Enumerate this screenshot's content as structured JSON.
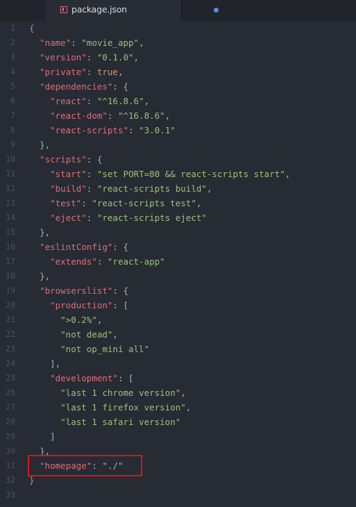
{
  "tab": {
    "filename": "package.json",
    "icon": "file-json-icon",
    "modified": true
  },
  "editor": {
    "lines": [
      {
        "n": "1",
        "t": "{"
      },
      {
        "n": "2",
        "t": "  \"name\": \"movie_app\","
      },
      {
        "n": "3",
        "t": "  \"version\": \"0.1.0\","
      },
      {
        "n": "4",
        "t": "  \"private\": true,"
      },
      {
        "n": "5",
        "t": "  \"dependencies\": {"
      },
      {
        "n": "6",
        "t": "    \"react\": \"^16.8.6\","
      },
      {
        "n": "7",
        "t": "    \"react-dom\": \"^16.8.6\","
      },
      {
        "n": "8",
        "t": "    \"react-scripts\": \"3.0.1\""
      },
      {
        "n": "9",
        "t": "  },"
      },
      {
        "n": "10",
        "t": "  \"scripts\": {"
      },
      {
        "n": "11",
        "t": "    \"start\": \"set PORT=80 && react-scripts start\","
      },
      {
        "n": "12",
        "t": "    \"build\": \"react-scripts build\","
      },
      {
        "n": "13",
        "t": "    \"test\": \"react-scripts test\","
      },
      {
        "n": "14",
        "t": "    \"eject\": \"react-scripts eject\""
      },
      {
        "n": "15",
        "t": "  },"
      },
      {
        "n": "16",
        "t": "  \"eslintConfig\": {"
      },
      {
        "n": "17",
        "t": "    \"extends\": \"react-app\""
      },
      {
        "n": "18",
        "t": "  },"
      },
      {
        "n": "19",
        "t": "  \"browserslist\": {"
      },
      {
        "n": "20",
        "t": "    \"production\": ["
      },
      {
        "n": "21",
        "t": "      \">0.2%\","
      },
      {
        "n": "22",
        "t": "      \"not dead\","
      },
      {
        "n": "23",
        "t": "      \"not op_mini all\""
      },
      {
        "n": "24",
        "t": "    ],"
      },
      {
        "n": "25",
        "t": "    \"development\": ["
      },
      {
        "n": "26",
        "t": "      \"last 1 chrome version\","
      },
      {
        "n": "27",
        "t": "      \"last 1 firefox version\","
      },
      {
        "n": "28",
        "t": "      \"last 1 safari version\""
      },
      {
        "n": "29",
        "t": "    ]"
      },
      {
        "n": "30",
        "t": "  },"
      },
      {
        "n": "31",
        "t": "  \"homepage\": \"./\""
      },
      {
        "n": "32",
        "t": "}"
      },
      {
        "n": "33",
        "t": ""
      }
    ],
    "highlighted_line": "31"
  },
  "colors": {
    "background": "#272b33",
    "key": "#e06c75",
    "string": "#98c379",
    "boolean": "#d19a66",
    "punctuation": "#abb2bf",
    "highlight_box": "#e0121a",
    "modified_dot": "#568af2"
  }
}
